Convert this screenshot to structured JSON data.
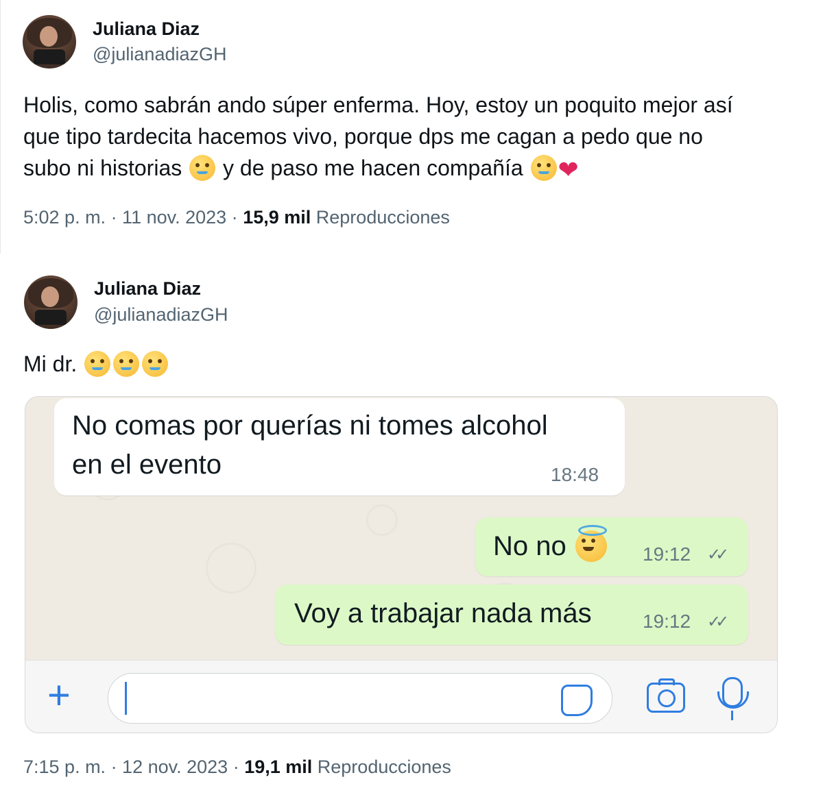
{
  "tweets": [
    {
      "name": "Juliana Diaz",
      "handle": "@julianadiazGH",
      "text_parts": {
        "line1": "Holis, como sabrán ando súper enferma. Hoy, estoy un poquito mejor así",
        "line2": "que tipo tardecita hacemos vivo, porque dps me cagan a pedo que no",
        "line3a": "subo ni historias",
        "line3b": "y de paso me hacen compañía"
      },
      "time": "5:02 p. m. · 11 nov. 2023 ·",
      "views_count": "15,9 mil",
      "views_label": "Reproducciones"
    },
    {
      "name": "Juliana Diaz",
      "handle": "@julianadiazGH",
      "text": "Mi dr.",
      "time": "7:15 p. m. · 12 nov. 2023 ·",
      "views_count": "19,1 mil",
      "views_label": "Reproducciones"
    }
  ],
  "chat": {
    "messages": [
      {
        "line1": "No comas por querías ni tomes alcohol",
        "line2": "en el evento",
        "time": "18:48",
        "direction": "incoming"
      },
      {
        "text": "No no",
        "time": "19:12",
        "direction": "outgoing"
      },
      {
        "text": "Voy a trabajar nada más",
        "time": "19:12",
        "direction": "outgoing"
      }
    ],
    "ticks": "✓✓",
    "accent": "#2f7de1",
    "incoming_color": "#ffffff",
    "outgoing_color": "#dcf8c6"
  },
  "icons": {
    "plus": "+"
  }
}
